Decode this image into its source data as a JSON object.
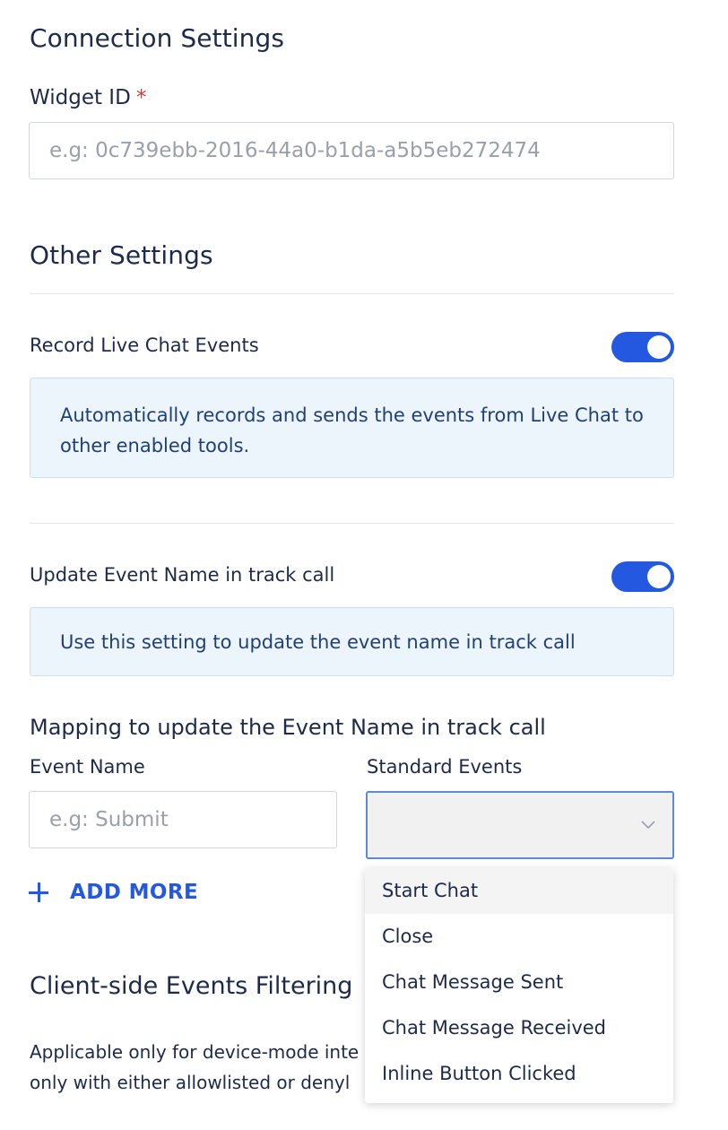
{
  "connection": {
    "title": "Connection Settings",
    "widget_label": "Widget ID",
    "required_mark": "*",
    "widget_value": "",
    "widget_placeholder": "e.g: 0c739ebb-2016-44a0-b1da-a5b5eb272474"
  },
  "other": {
    "title": "Other Settings",
    "record_label": "Record Live Chat Events",
    "record_enabled": true,
    "record_info": "Automatically records and sends the events from Live Chat to other enabled tools.",
    "update_label": "Update Event Name in track call",
    "update_enabled": true,
    "update_info": "Use this setting to update the event name in track call"
  },
  "mapping": {
    "title": "Mapping to update the Event Name in track call",
    "col_event_name": "Event Name",
    "col_standard_events": "Standard Events",
    "event_name_value": "",
    "event_name_placeholder": "e.g: Submit",
    "standard_selected": "",
    "add_more": "ADD MORE",
    "options": [
      "Start Chat",
      "Close",
      "Chat Message Sent",
      "Chat Message Received",
      "Inline Button Clicked"
    ],
    "highlighted_option": "Start Chat"
  },
  "client_side": {
    "title": "Client-side Events Filtering",
    "desc_line1": "Applicable only for device-mode inte",
    "desc_line2": "only with either allowlisted or denyl"
  },
  "colors": {
    "accent": "#2458e0",
    "info_bg": "#ecf4fc",
    "required": "#e5322d"
  }
}
